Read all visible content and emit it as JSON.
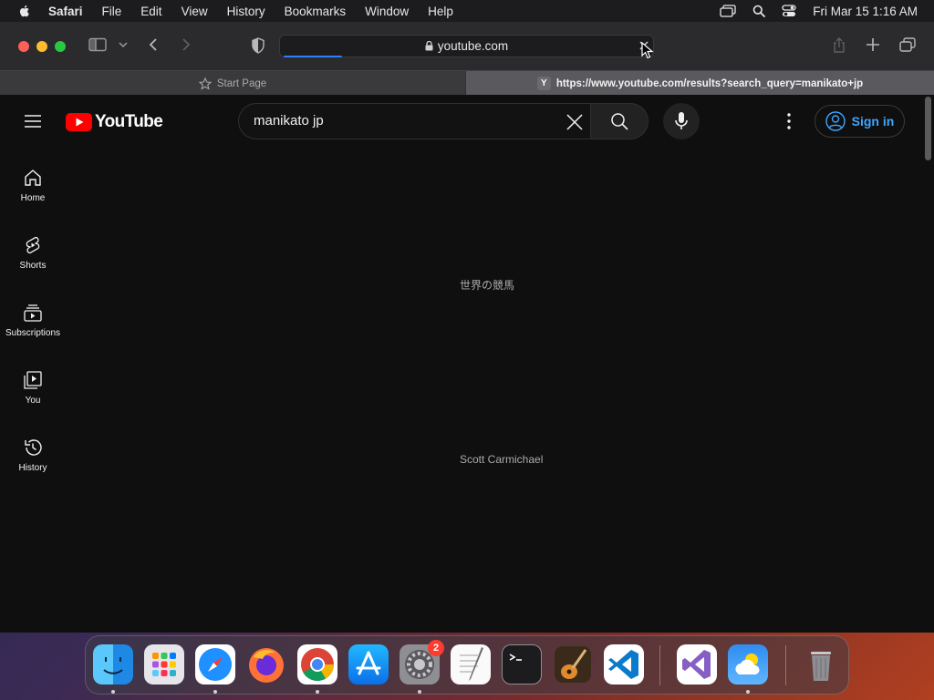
{
  "menubar": {
    "app": "Safari",
    "items": [
      "File",
      "Edit",
      "View",
      "History",
      "Bookmarks",
      "Window",
      "Help"
    ],
    "clock": "Fri Mar 15  1:16 AM"
  },
  "safari": {
    "address": "youtube.com",
    "tabs": [
      {
        "label": "Start Page",
        "active": false
      },
      {
        "label": "https://www.youtube.com/results?search_query=manikato+jp",
        "favicon": "Y",
        "active": true
      }
    ]
  },
  "youtube": {
    "logo_text": "YouTube",
    "search_query": "manikato jp",
    "sign_in": "Sign in",
    "rail": [
      "Home",
      "Shorts",
      "Subscriptions",
      "You",
      "History"
    ],
    "content": {
      "video_title": "世界の競馬",
      "channel": "Scott Carmichael"
    }
  },
  "dock": {
    "apps": [
      "Finder",
      "Launchpad",
      "Safari",
      "Firefox",
      "Chrome",
      "App Store",
      "System Settings",
      "TextEdit",
      "Terminal",
      "GarageBand",
      "Visual Studio Code",
      "Visual Studio",
      "Weather",
      "Trash"
    ],
    "settings_badge": "2"
  },
  "colors": {
    "youtube_red": "#ff0000",
    "link_blue": "#3ea6ff",
    "progress_blue": "#2f7ff6"
  }
}
